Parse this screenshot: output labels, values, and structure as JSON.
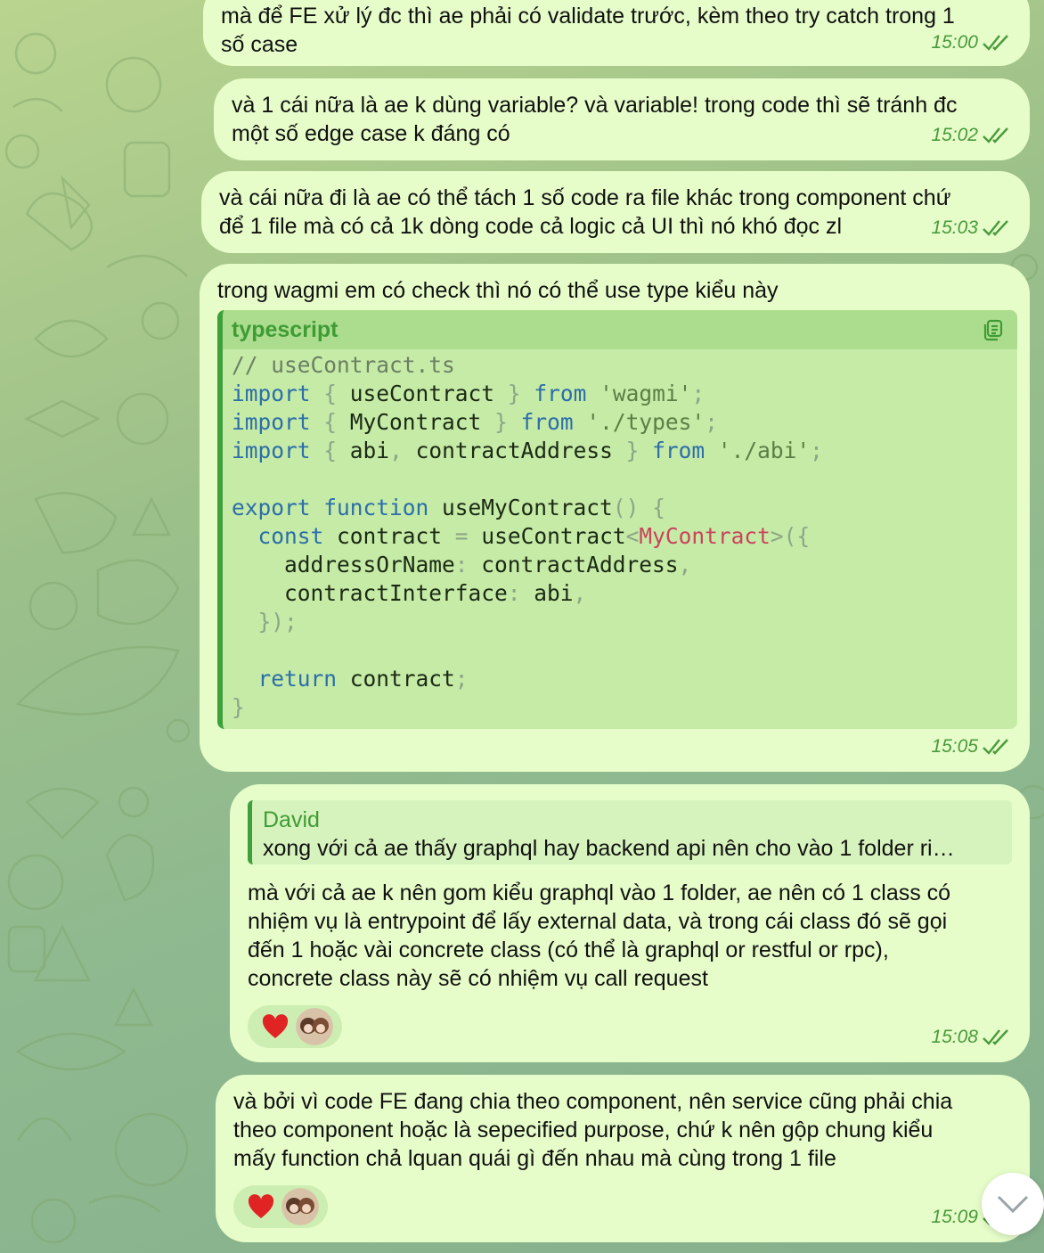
{
  "messages": [
    {
      "text": "mà để FE xử lý đc thì ae phải có validate trước, kèm theo try catch trong 1\nsố case",
      "time": "15:00"
    },
    {
      "text": "và 1 cái nữa là ae k dùng variable? và variable! trong code thì sẽ tránh đc\nmột số edge case k đáng có",
      "time": "15:02"
    },
    {
      "text": "và cái nữa đi là ae có thể tách 1 số code ra file khác trong component chứ\nđể 1 file mà có cả 1k dòng code cả logic cả UI thì nó khó đọc zl",
      "time": "15:03"
    },
    {
      "text": "trong wagmi em có check thì nó có thể use type kiểu này",
      "time": "15:05",
      "code": {
        "language": "typescript"
      }
    },
    {
      "reply_name": "David",
      "reply_text": "xong với cả ae thấy graphql hay backend api nên cho vào 1 folder ri…",
      "text": "mà với cả ae k nên gom kiểu graphql vào 1 folder, ae nên có 1 class có\nnhiệm vụ là entrypoint để lấy external data, và trong cái class đó sẽ gọi\nđến 1 hoặc vài concrete class (có thể là graphql or restful or rpc),\nconcrete class này sẽ có nhiệm vụ call request",
      "time": "15:08"
    },
    {
      "text": "và bởi vì code FE đang chia theo component, nên service cũng phải chia\ntheo component hoặc là sepecified purpose, chứ k nên gộp chung kiểu\nmấy function chả lquan quái gì đến nhau mà cùng trong 1 file",
      "time": "15:09"
    }
  ],
  "code": {
    "lines": [
      [
        [
          "// useContract.ts",
          "comment"
        ]
      ],
      [
        [
          "import",
          "kw"
        ],
        [
          " ",
          ""
        ],
        [
          "{",
          "punc"
        ],
        [
          " useContract ",
          ""
        ],
        [
          "}",
          "punc"
        ],
        [
          " ",
          ""
        ],
        [
          "from",
          "kw"
        ],
        [
          " ",
          ""
        ],
        [
          "'wagmi'",
          "str"
        ],
        [
          ";",
          "punc"
        ]
      ],
      [
        [
          "import",
          "kw"
        ],
        [
          " ",
          ""
        ],
        [
          "{",
          "punc"
        ],
        [
          " MyContract ",
          ""
        ],
        [
          "}",
          "punc"
        ],
        [
          " ",
          ""
        ],
        [
          "from",
          "kw"
        ],
        [
          " ",
          ""
        ],
        [
          "'./types'",
          "str"
        ],
        [
          ";",
          "punc"
        ]
      ],
      [
        [
          "import",
          "kw"
        ],
        [
          " ",
          ""
        ],
        [
          "{",
          "punc"
        ],
        [
          " abi",
          ""
        ],
        [
          ",",
          "punc"
        ],
        [
          " contractAddress ",
          ""
        ],
        [
          "}",
          "punc"
        ],
        [
          " ",
          ""
        ],
        [
          "from",
          "kw"
        ],
        [
          " ",
          ""
        ],
        [
          "'./abi'",
          "str"
        ],
        [
          ";",
          "punc"
        ]
      ],
      [],
      [
        [
          "export",
          "kw"
        ],
        [
          " ",
          ""
        ],
        [
          "function",
          "kw"
        ],
        [
          " useMyContract",
          ""
        ],
        [
          "()",
          "punc"
        ],
        [
          " ",
          ""
        ],
        [
          "{",
          "punc"
        ]
      ],
      [
        [
          "  ",
          ""
        ],
        [
          "const",
          "kw"
        ],
        [
          " contract ",
          ""
        ],
        [
          "=",
          "punc"
        ],
        [
          " useContract",
          ""
        ],
        [
          "<",
          "punc"
        ],
        [
          "MyContract",
          "type"
        ],
        [
          ">({",
          "punc"
        ]
      ],
      [
        [
          "    addressOrName",
          ""
        ],
        [
          ":",
          "punc"
        ],
        [
          " contractAddress",
          ""
        ],
        [
          ",",
          "punc"
        ]
      ],
      [
        [
          "    contractInterface",
          ""
        ],
        [
          ":",
          "punc"
        ],
        [
          " abi",
          ""
        ],
        [
          ",",
          "punc"
        ]
      ],
      [
        [
          "  ",
          ""
        ],
        [
          "});",
          "punc"
        ]
      ],
      [],
      [
        [
          "  ",
          ""
        ],
        [
          "return",
          "kw"
        ],
        [
          " contract",
          ""
        ],
        [
          ";",
          "punc"
        ]
      ],
      [
        [
          "}",
          "punc"
        ]
      ]
    ]
  },
  "reactions": [
    {
      "emoji": "heart"
    },
    {
      "emoji": "heart"
    }
  ],
  "icons": [
    "double-check-icon",
    "copy-icon",
    "heart-icon",
    "chevron-down-icon"
  ],
  "colors": {
    "bubble": "#e6fdc9",
    "accent": "#3fa03b",
    "time": "#4a9a3c"
  }
}
